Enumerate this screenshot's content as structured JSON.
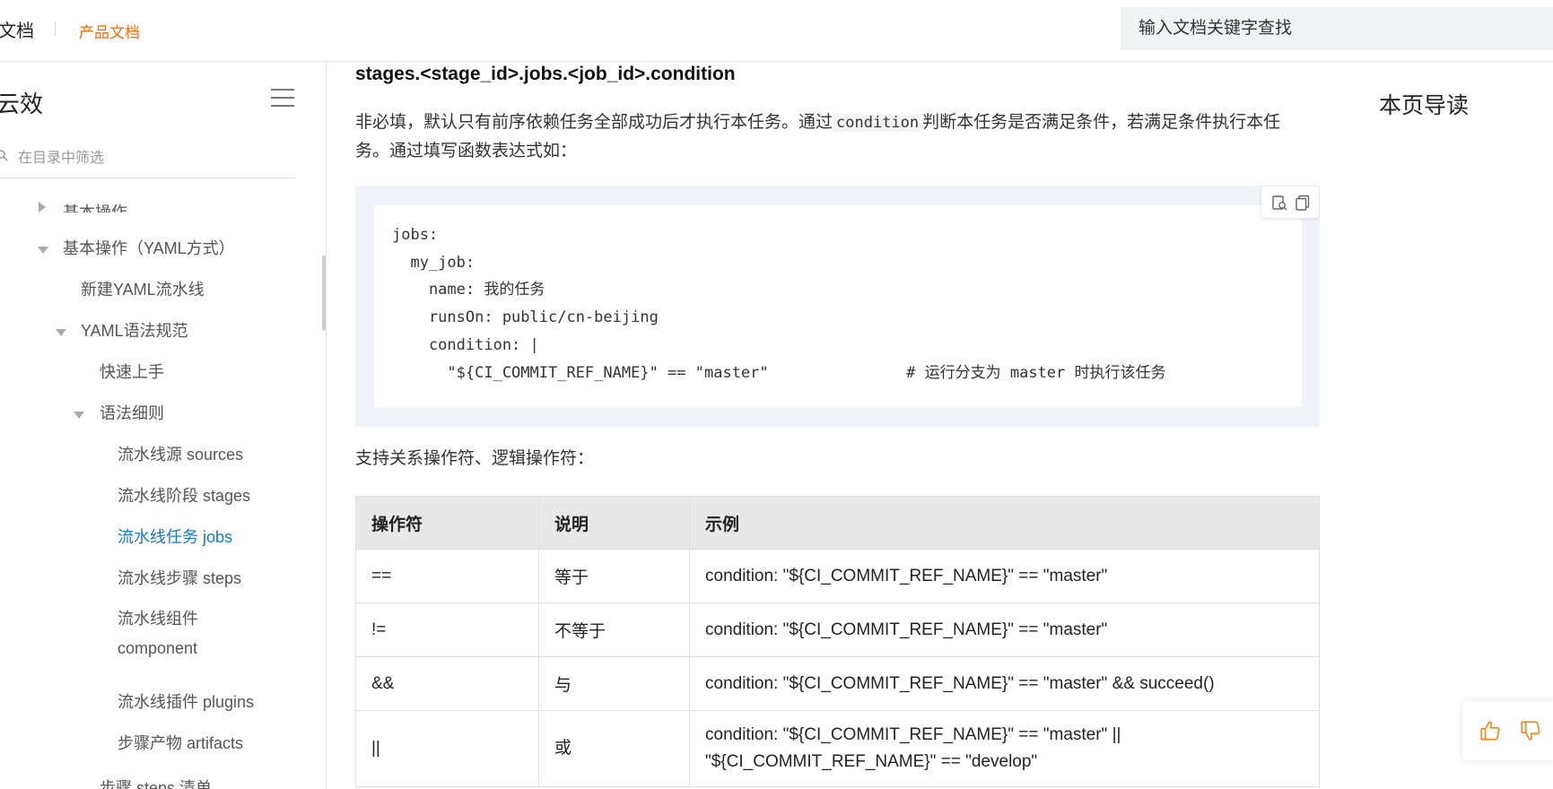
{
  "header": {
    "brand": "文档",
    "product_docs": "产品文档",
    "search_placeholder": "输入文档关键字查找"
  },
  "sidebar": {
    "title": "云效",
    "filter_placeholder": "在目录中筛选",
    "items": [
      {
        "label": "基本操作",
        "expanded": false
      },
      {
        "label": "基本操作（YAML方式）",
        "expanded": true
      },
      {
        "label": "新建YAML流水线"
      },
      {
        "label": "YAML语法规范",
        "expanded": true
      },
      {
        "label": "快速上手"
      },
      {
        "label": "语法细则",
        "expanded": true
      },
      {
        "label": "流水线源 sources"
      },
      {
        "label": "流水线阶段 stages"
      },
      {
        "label": "流水线任务 jobs",
        "active": true
      },
      {
        "label": "流水线步骤 steps"
      },
      {
        "label": "流水线组件",
        "label_line2": "component"
      },
      {
        "label": "流水线插件 plugins"
      },
      {
        "label": "步骤产物 artifacts"
      },
      {
        "label": "步骤 steps 清单"
      }
    ]
  },
  "main": {
    "heading": "stages.<stage_id>.jobs.<job_id>.condition",
    "para1_before": "非必填，默认只有前序依赖任务全部成功后才执行本任务。通过",
    "para1_code": "condition",
    "para1_after": "判断本任务是否满足条件，若满足条件执行本任",
    "para1_line2": "务。通过填写函数表达式如：",
    "code_lines": [
      "jobs:",
      "  my_job:",
      "    name: 我的任务",
      "    runsOn: public/cn-beijing",
      "    condition: |",
      "      \"${CI_COMMIT_REF_NAME}\" == \"master\"               # 运行分支为 master 时执行该任务"
    ],
    "para2": "支持关系操作符、逻辑操作符：",
    "table": {
      "headers": [
        "操作符",
        "说明",
        "示例"
      ],
      "rows": [
        [
          "==",
          "等于",
          "condition: \"${CI_COMMIT_REF_NAME}\" == \"master\""
        ],
        [
          "!=",
          "不等于",
          "condition: \"${CI_COMMIT_REF_NAME}\" == \"master\""
        ],
        [
          "&&",
          "与",
          "condition: \"${CI_COMMIT_REF_NAME}\" == \"master\" && succeed()"
        ],
        [
          "||",
          "或",
          "condition: \"${CI_COMMIT_REF_NAME}\" == \"master\" ||",
          "\"${CI_COMMIT_REF_NAME}\" == \"develop\""
        ]
      ]
    }
  },
  "toc": {
    "title": "本页导读"
  },
  "icons": {
    "menu": "hamburger-icon",
    "filter": "search-icon",
    "code_view": "view-code-icon",
    "code_copy": "copy-icon",
    "like": "thumbs-up-icon",
    "dislike": "thumbs-down-icon"
  },
  "colors": {
    "accent": "#ff6a00",
    "link_active": "#1677d2",
    "code_bg": "#f0f4f8",
    "table_header_bg": "#e8e8e8"
  }
}
